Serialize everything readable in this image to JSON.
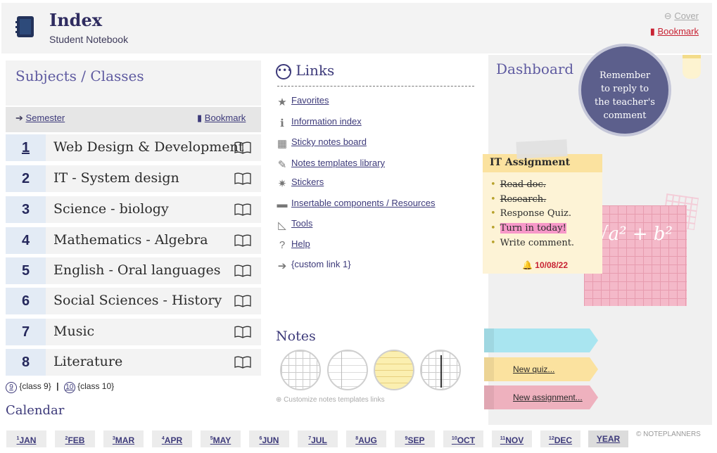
{
  "header": {
    "title": "Index",
    "subtitle": "Student Notebook",
    "cover_label": "Cover",
    "bookmark_label": "Bookmark"
  },
  "subjects": {
    "title": "Subjects / Classes",
    "semester_label": "Semester",
    "bookmark_label": "Bookmark",
    "items": [
      {
        "num": "1",
        "name": "Web Design & Development"
      },
      {
        "num": "2",
        "name": "IT - System design"
      },
      {
        "num": "3",
        "name": "Science - biology"
      },
      {
        "num": "4",
        "name": "Mathematics - Algebra"
      },
      {
        "num": "5",
        "name": "English - Oral languages"
      },
      {
        "num": "6",
        "name": "Social Sciences - History"
      },
      {
        "num": "7",
        "name": "Music"
      },
      {
        "num": "8",
        "name": "Literature"
      }
    ],
    "extra": [
      {
        "num": "9",
        "label": "{class 9}"
      },
      {
        "num": "10",
        "label": "{class 10}"
      }
    ]
  },
  "calendar": {
    "title": "Calendar",
    "months": [
      {
        "n": "1",
        "label": "JAN"
      },
      {
        "n": "2",
        "label": "FEB"
      },
      {
        "n": "3",
        "label": "MAR"
      },
      {
        "n": "4",
        "label": "APR"
      },
      {
        "n": "5",
        "label": "MAY"
      },
      {
        "n": "6",
        "label": "JUN"
      },
      {
        "n": "7",
        "label": "JUL"
      },
      {
        "n": "8",
        "label": "AUG"
      },
      {
        "n": "9",
        "label": "SEP"
      },
      {
        "n": "10",
        "label": "OCT"
      },
      {
        "n": "11",
        "label": "NOV"
      },
      {
        "n": "12",
        "label": "DEC"
      }
    ],
    "year_label": "YEAR"
  },
  "copyright": "© NOTEPLANNERS",
  "links": {
    "title": "Links",
    "items": [
      {
        "icon": "star-icon",
        "label": "Favorites"
      },
      {
        "icon": "info-icon",
        "label": "Information index"
      },
      {
        "icon": "grid-icon",
        "label": "Sticky notes board"
      },
      {
        "icon": "pencil-icon",
        "label": "Notes templates library"
      },
      {
        "icon": "sticker-icon",
        "label": "Stickers"
      },
      {
        "icon": "folder-icon",
        "label": "Insertable components / Resources"
      },
      {
        "icon": "ruler-icon",
        "label": "Tools"
      },
      {
        "icon": "help-icon",
        "label": "Help"
      },
      {
        "icon": "arrow-circle-icon",
        "label": "{custom link 1}"
      }
    ]
  },
  "notes": {
    "title": "Notes",
    "customize_label": "Customize notes templates links"
  },
  "dashboard": {
    "title": "Dashboard",
    "reminder": [
      "Remember",
      "to reply to",
      "the teacher's",
      "comment"
    ],
    "assignment": {
      "title": "IT Assignment",
      "tasks": [
        {
          "text": "Read doc.",
          "state": "done"
        },
        {
          "text": "Research.",
          "state": "done"
        },
        {
          "text": "Response Quiz.",
          "state": "open"
        },
        {
          "text": "Turn in today!",
          "state": "highlight"
        },
        {
          "text": "Write comment.",
          "state": "open"
        }
      ],
      "due": "10/08/22"
    },
    "formula": "√a² + b²",
    "banners": [
      {
        "label": "",
        "color": "#a9e5f0"
      },
      {
        "label": "New quiz...",
        "color": "#fbe29f"
      },
      {
        "label": "New assignment...",
        "color": "#eeb1be"
      }
    ]
  }
}
